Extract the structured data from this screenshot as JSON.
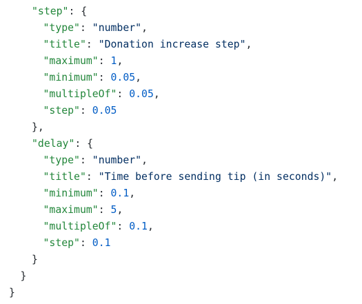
{
  "code": {
    "lines": [
      {
        "indent": 2,
        "tokens": [
          {
            "t": "key",
            "v": "\"step\""
          },
          {
            "t": "pun",
            "v": ": {"
          }
        ]
      },
      {
        "indent": 3,
        "tokens": [
          {
            "t": "key",
            "v": "\"type\""
          },
          {
            "t": "pun",
            "v": ": "
          },
          {
            "t": "str",
            "v": "\"number\""
          },
          {
            "t": "pun",
            "v": ","
          }
        ]
      },
      {
        "indent": 3,
        "tokens": [
          {
            "t": "key",
            "v": "\"title\""
          },
          {
            "t": "pun",
            "v": ": "
          },
          {
            "t": "str",
            "v": "\"Donation increase step\""
          },
          {
            "t": "pun",
            "v": ","
          }
        ]
      },
      {
        "indent": 3,
        "tokens": [
          {
            "t": "key",
            "v": "\"maximum\""
          },
          {
            "t": "pun",
            "v": ": "
          },
          {
            "t": "num",
            "v": "1"
          },
          {
            "t": "pun",
            "v": ","
          }
        ]
      },
      {
        "indent": 3,
        "tokens": [
          {
            "t": "key",
            "v": "\"minimum\""
          },
          {
            "t": "pun",
            "v": ": "
          },
          {
            "t": "num",
            "v": "0.05"
          },
          {
            "t": "pun",
            "v": ","
          }
        ]
      },
      {
        "indent": 3,
        "tokens": [
          {
            "t": "key",
            "v": "\"multipleOf\""
          },
          {
            "t": "pun",
            "v": ": "
          },
          {
            "t": "num",
            "v": "0.05"
          },
          {
            "t": "pun",
            "v": ","
          }
        ]
      },
      {
        "indent": 3,
        "tokens": [
          {
            "t": "key",
            "v": "\"step\""
          },
          {
            "t": "pun",
            "v": ": "
          },
          {
            "t": "num",
            "v": "0.05"
          }
        ]
      },
      {
        "indent": 2,
        "tokens": [
          {
            "t": "pun",
            "v": "},"
          }
        ]
      },
      {
        "indent": 2,
        "tokens": [
          {
            "t": "key",
            "v": "\"delay\""
          },
          {
            "t": "pun",
            "v": ": {"
          }
        ]
      },
      {
        "indent": 3,
        "tokens": [
          {
            "t": "key",
            "v": "\"type\""
          },
          {
            "t": "pun",
            "v": ": "
          },
          {
            "t": "str",
            "v": "\"number\""
          },
          {
            "t": "pun",
            "v": ","
          }
        ]
      },
      {
        "indent": 3,
        "tokens": [
          {
            "t": "key",
            "v": "\"title\""
          },
          {
            "t": "pun",
            "v": ": "
          },
          {
            "t": "str",
            "v": "\"Time before sending tip (in seconds)\""
          },
          {
            "t": "pun",
            "v": ","
          }
        ]
      },
      {
        "indent": 3,
        "tokens": [
          {
            "t": "key",
            "v": "\"minimum\""
          },
          {
            "t": "pun",
            "v": ": "
          },
          {
            "t": "num",
            "v": "0.1"
          },
          {
            "t": "pun",
            "v": ","
          }
        ]
      },
      {
        "indent": 3,
        "tokens": [
          {
            "t": "key",
            "v": "\"maximum\""
          },
          {
            "t": "pun",
            "v": ": "
          },
          {
            "t": "num",
            "v": "5"
          },
          {
            "t": "pun",
            "v": ","
          }
        ]
      },
      {
        "indent": 3,
        "tokens": [
          {
            "t": "key",
            "v": "\"multipleOf\""
          },
          {
            "t": "pun",
            "v": ": "
          },
          {
            "t": "num",
            "v": "0.1"
          },
          {
            "t": "pun",
            "v": ","
          }
        ]
      },
      {
        "indent": 3,
        "tokens": [
          {
            "t": "key",
            "v": "\"step\""
          },
          {
            "t": "pun",
            "v": ": "
          },
          {
            "t": "num",
            "v": "0.1"
          }
        ]
      },
      {
        "indent": 2,
        "tokens": [
          {
            "t": "pun",
            "v": "}"
          }
        ]
      },
      {
        "indent": 1,
        "tokens": [
          {
            "t": "pun",
            "v": "}"
          }
        ]
      },
      {
        "indent": 0,
        "tokens": [
          {
            "t": "pun",
            "v": "}"
          }
        ]
      }
    ]
  },
  "colors": {
    "key": "#22863a",
    "string": "#032f62",
    "number": "#005cc5",
    "punctuation": "#24292e",
    "background": "#ffffff"
  }
}
